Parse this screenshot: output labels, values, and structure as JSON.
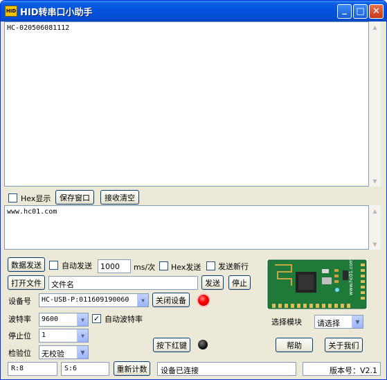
{
  "window": {
    "title": "HID转串口小助手",
    "icon_text": "HID"
  },
  "title_buttons": {
    "minimize": "_",
    "maximize": "□",
    "close": "✕"
  },
  "receive": {
    "content": "HC-020506081112"
  },
  "receive_toolbar": {
    "hex_display_label": "Hex显示",
    "hex_display_checked": false,
    "save_window_label": "保存窗口",
    "clear_receive_label": "接收清空"
  },
  "send": {
    "content": "www.hc01.com"
  },
  "controls": {
    "send_data_label": "数据发送",
    "auto_send_label": "自动发送",
    "auto_send_checked": false,
    "interval_value": "1000",
    "interval_unit": "ms/次",
    "hex_send_label": "Hex发送",
    "hex_send_checked": false,
    "send_newline_label": "发送新行",
    "send_newline_checked": false,
    "open_file_label": "打开文件",
    "file_name_value": "文件名",
    "file_send_label": "发送",
    "stop_label": "停止",
    "device_label": "设备号",
    "device_value": "HC-USB-P:011609190060",
    "close_device_label": "关闭设备",
    "baud_label": "波特率",
    "baud_value": "9600",
    "auto_baud_label": "自动波特率",
    "auto_baud_checked": true,
    "stop_bits_label": "停止位",
    "stop_bits_value": "1",
    "parity_label": "检验位",
    "parity_value": "无校验",
    "press_red_key_label": "按下红键",
    "select_module_label": "选择模块",
    "select_module_value": "请选择",
    "help_label": "帮助",
    "about_label": "关于我们"
  },
  "status_bar": {
    "rx_count": "R:8",
    "tx_count": "S:6",
    "reset_count_label": "重新计数",
    "device_status": "设备已连接",
    "version": "版本号：V2.1"
  },
  "module_image": {
    "brand_text": "www.hc01.com"
  },
  "colors": {
    "title_blue": "#0453dd",
    "window_face": "#ece9d8",
    "led_red": "#ff0000",
    "pcb_green": "#1f7a3a"
  }
}
